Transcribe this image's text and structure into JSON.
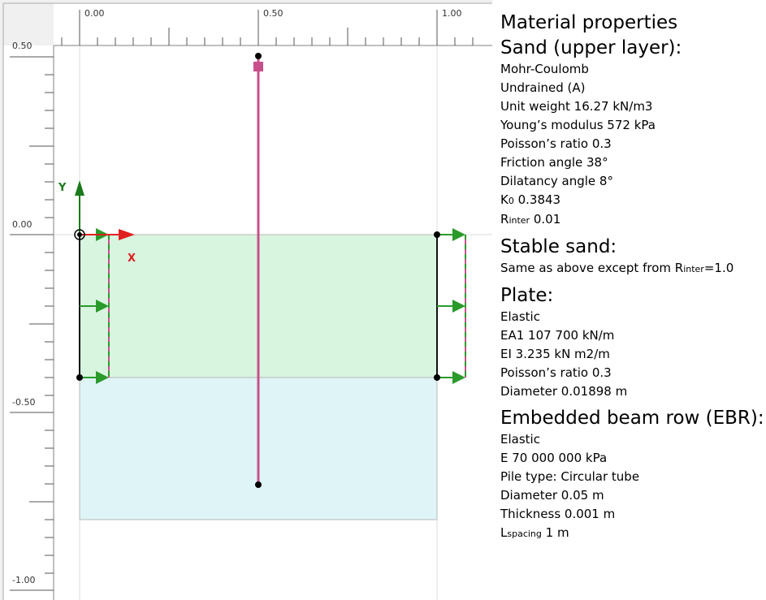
{
  "canvas": {
    "x_ticks": [
      "0.00",
      "0.50",
      "1.00"
    ],
    "y_ticks": [
      "0.50",
      "0.00",
      "-0.50",
      "-1.00"
    ],
    "axis_x_label": "X",
    "axis_y_label": "Y",
    "colors": {
      "upper_layer": "#d8f5e0",
      "lower_layer": "#dff4f6",
      "beam": "#c8508a",
      "x_axis": "#e02020",
      "y_axis": "#1a7a1a",
      "boundary_arrow": "#2a9a2a"
    }
  },
  "props": {
    "title": "Material properties",
    "sand": {
      "heading": "Sand (upper layer):",
      "model": "Mohr-Coulomb",
      "drainage": "Undrained (A)",
      "unit_weight": "Unit weight 16.27 kN/m3",
      "youngs": "Young’s modulus 572 kPa",
      "poisson": "Poisson’s ratio 0.3",
      "friction": "Friction angle 38°",
      "dilatancy": "Dilatancy angle 8°",
      "k0_main": "K",
      "k0_sub": "0",
      "k0_value": " 0.3843",
      "rinter_main": "R",
      "rinter_sub": "inter",
      "rinter_value": " 0.01"
    },
    "stable": {
      "heading": "Stable sand:",
      "text_a": "Same as above except from R",
      "text_sub": "inter",
      "text_b": "=1.0"
    },
    "plate": {
      "heading": "Plate:",
      "model": "Elastic",
      "ea1": "EA1 107 700 kN/m",
      "ei": "EI 3.235 kN m2/m",
      "poisson": "Poisson’s ratio 0.3",
      "diameter": "Diameter 0.01898 m"
    },
    "ebr": {
      "heading": "Embedded beam row (EBR):",
      "model": "Elastic",
      "e": "E 70 000 000 kPa",
      "pile_type": "Pile type: Circular tube",
      "diameter": "Diameter 0.05 m",
      "thickness": "Thickness 0.001 m",
      "lspacing_main": "L",
      "lspacing_sub": "spacing",
      "lspacing_value": " 1 m"
    }
  }
}
